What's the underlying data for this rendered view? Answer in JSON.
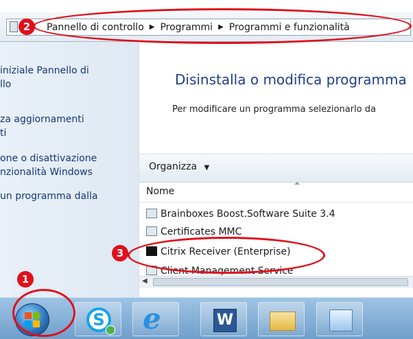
{
  "address_bar": {
    "breadcrumbs": [
      "Pannello di controllo",
      "Programmi",
      "Programmi e funzionalità"
    ]
  },
  "left_pane": {
    "links": [
      "iniziale Pannello di\nllo",
      "za aggiornamenti\nti",
      "one o disattivazione\nnzionalità Windows",
      "un programma dalla"
    ]
  },
  "main": {
    "title": "Disinstalla o modifica programma",
    "description": "Per modificare un programma selezionarlo da",
    "toolbar_organize": "Organizza"
  },
  "program_list": {
    "column_header": "Nome",
    "rows": [
      "Brainboxes Boost.Software Suite 3.4",
      "Certificates MMC",
      "Citrix Receiver (Enterprise)",
      "Client Management Service"
    ]
  },
  "taskbar": {
    "items": [
      "start",
      "skype",
      "internet-explorer",
      "word",
      "windows-explorer",
      "control-panel"
    ]
  },
  "annotations": {
    "badges": [
      "1",
      "2",
      "3"
    ],
    "color": "#e0101b"
  },
  "colors": {
    "link": "#15387a",
    "title": "#1f3e8a",
    "taskbar": "#7fa9d1"
  }
}
